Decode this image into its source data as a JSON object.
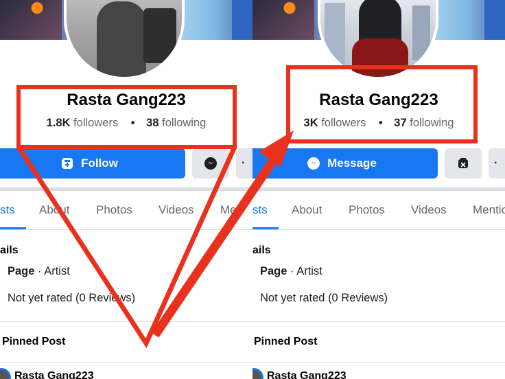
{
  "left": {
    "name": "Rasta Gang223",
    "followers_count": "1.8K",
    "followers_label": "followers",
    "following_count": "38",
    "following_label": "following",
    "primary_button": "Follow",
    "tabs": [
      "sts",
      "About",
      "Photos",
      "Videos",
      "Me"
    ],
    "details_title": "ails",
    "page_label": "Page",
    "category": " · Artist",
    "rating": "Not yet rated (0 Reviews)",
    "pinned_title": "Pinned Post",
    "post_author": "Rasta Gang223"
  },
  "right": {
    "name": "Rasta Gang223",
    "followers_count": "3K",
    "followers_label": "followers",
    "following_count": "37",
    "following_label": "following",
    "primary_button": "Message",
    "tabs": [
      "sts",
      "About",
      "Photos",
      "Videos",
      "Mentio"
    ],
    "details_title": "ails",
    "page_label": "Page",
    "category": " · Artist",
    "rating": "Not yet rated (0 Reviews)",
    "pinned_title": "Pinned Post",
    "post_author": "Rasta Gang223"
  },
  "dot_separator": "•",
  "colors": {
    "accent": "#1877f2",
    "annotation_red": "#e8321e",
    "secondary_button": "#e4e6eb"
  },
  "icons": {
    "follow": "add-page-icon",
    "message": "messenger-icon",
    "block": "block-user-icon",
    "more": "more-icon"
  }
}
